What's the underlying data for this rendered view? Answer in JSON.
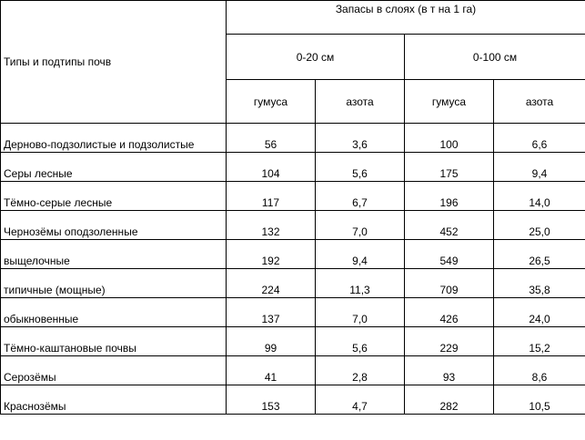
{
  "header": {
    "soil_types": "Типы и подтипы почв",
    "reserves": "Запасы в слоях (в т на 1 га)",
    "layer_0_20": "0-20 см",
    "layer_0_100": "0-100 см",
    "humus": "гумуса",
    "nitrogen": "азота"
  },
  "rows": [
    {
      "name": "Дерново-подзолистые и подзолистые",
      "humus_20": "56",
      "nitrogen_20": "3,6",
      "humus_100": "100",
      "nitrogen_100": "6,6"
    },
    {
      "name": "Серы лесные",
      "humus_20": "104",
      "nitrogen_20": "5,6",
      "humus_100": "175",
      "nitrogen_100": "9,4"
    },
    {
      "name": "Тёмно-серые лесные",
      "humus_20": "117",
      "nitrogen_20": "6,7",
      "humus_100": "196",
      "nitrogen_100": "14,0"
    },
    {
      "name": "Чернозёмы оподзоленные",
      "humus_20": "132",
      "nitrogen_20": "7,0",
      "humus_100": "452",
      "nitrogen_100": "25,0"
    },
    {
      "name": "выщелочные",
      "humus_20": "192",
      "nitrogen_20": "9,4",
      "humus_100": "549",
      "nitrogen_100": "26,5"
    },
    {
      "name": "типичные (мощные)",
      "humus_20": "224",
      "nitrogen_20": "11,3",
      "humus_100": "709",
      "nitrogen_100": "35,8"
    },
    {
      "name": "обыкновенные",
      "humus_20": "137",
      "nitrogen_20": "7,0",
      "humus_100": "426",
      "nitrogen_100": "24,0"
    },
    {
      "name": "Тёмно-каштановые почвы",
      "humus_20": "99",
      "nitrogen_20": "5,6",
      "humus_100": "229",
      "nitrogen_100": "15,2"
    },
    {
      "name": "Серозёмы",
      "humus_20": "41",
      "nitrogen_20": "2,8",
      "humus_100": "93",
      "nitrogen_100": "8,6"
    },
    {
      "name": "Краснозёмы",
      "humus_20": "153",
      "nitrogen_20": "4,7",
      "humus_100": "282",
      "nitrogen_100": "10,5"
    }
  ]
}
